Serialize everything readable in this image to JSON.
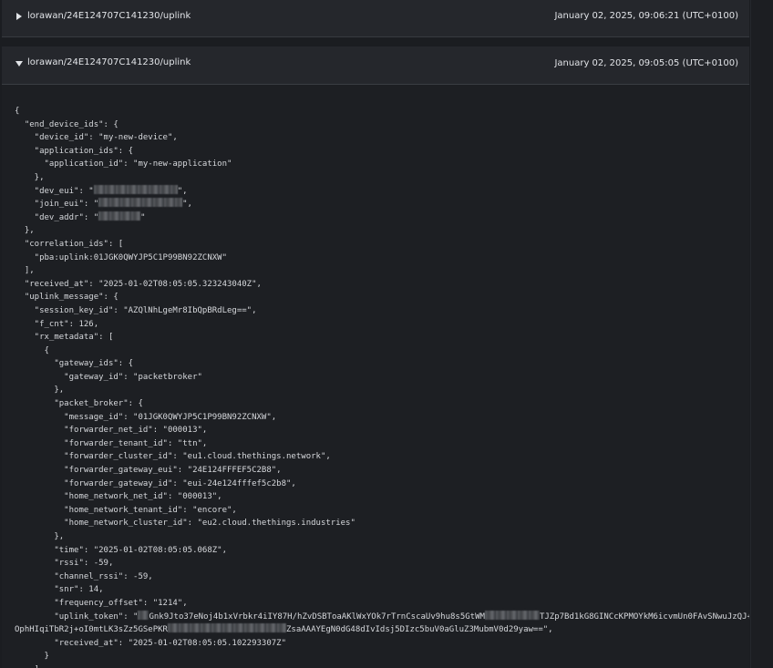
{
  "messages": [
    {
      "topic": "lorawan/24E124707C141230/uplink",
      "date": "January 02, 2025, 09:06:21 (UTC+0100)",
      "expanded": false
    },
    {
      "topic": "lorawan/24E124707C141230/uplink",
      "date": "January 02, 2025, 09:05:05 (UTC+0100)",
      "expanded": true
    }
  ],
  "payload": {
    "l1": "{",
    "l2": "  \"end_device_ids\": {",
    "l3": "    \"device_id\": \"my-new-device\",",
    "l4": "    \"application_ids\": {",
    "l5": "      \"application_id\": \"my-new-application\"",
    "l6": "    },",
    "l7": "    \"dev_eui\": \"",
    "l7b": "\",",
    "l8": "    \"join_eui\": \"",
    "l8b": "\",",
    "l9": "    \"dev_addr\": \"",
    "l9b": "\"",
    "l10": "  },",
    "l11": "  \"correlation_ids\": [",
    "l12": "    \"pba:uplink:01JGK0QWYJP5C1P99BN92ZCNXW\"",
    "l13": "  ],",
    "l14": "  \"received_at\": \"2025-01-02T08:05:05.323243040Z\",",
    "l15": "  \"uplink_message\": {",
    "l16": "    \"session_key_id\": \"AZQlNhLgeMr8IbQpBRdLeg==\",",
    "l17": "    \"f_cnt\": 126,",
    "l18": "    \"rx_metadata\": [",
    "l19": "      {",
    "l20": "        \"gateway_ids\": {",
    "l21": "          \"gateway_id\": \"packetbroker\"",
    "l22": "        },",
    "l23": "        \"packet_broker\": {",
    "l24": "          \"message_id\": \"01JGK0QWYJP5C1P99BN92ZCNXW\",",
    "l25": "          \"forwarder_net_id\": \"000013\",",
    "l26": "          \"forwarder_tenant_id\": \"ttn\",",
    "l27": "          \"forwarder_cluster_id\": \"eu1.cloud.thethings.network\",",
    "l28": "          \"forwarder_gateway_eui\": \"24E124FFFEF5C2B8\",",
    "l29": "          \"forwarder_gateway_id\": \"eui-24e124fffef5c2b8\",",
    "l30": "          \"home_network_net_id\": \"000013\",",
    "l31": "          \"home_network_tenant_id\": \"encore\",",
    "l32": "          \"home_network_cluster_id\": \"eu2.cloud.thethings.industries\"",
    "l33": "        },",
    "l34": "        \"time\": \"2025-01-02T08:05:05.068Z\",",
    "l35": "        \"rssi\": -59,",
    "l36": "        \"channel_rssi\": -59,",
    "l37": "        \"snr\": 14,",
    "l38": "        \"frequency_offset\": \"1214\",",
    "l39": "        \"uplink_token\": \"",
    "l39b": "Gnk9Jto37eNoj4b1xVrbkr4iIY87H/hZvDSBToaAKlWxYOk7rTrnCscaUv9hu8s5GtWM",
    "l39c": "TJZp7Bd1kG8GINCcKPMOYkM6icvmUn0FAvSNwuJzQJ+1",
    "l40": "OphHIqiTbR2j+oI0mtLK3sZz5GSePKR",
    "l40b": "ZsaAAAYEgN0dG48dIvIdsj5DIzc5buV0aGluZ3MubmV0d29yaw==\",",
    "l41": "        \"received_at\": \"2025-01-02T08:05:05.102293307Z\"",
    "l42": "      }",
    "l43": "    ],"
  },
  "icons": {
    "collapsed": "caret-right-icon",
    "expanded": "caret-down-icon"
  },
  "colors": {
    "background": "#1b1d21",
    "panel_header": "#25272c",
    "code_background": "#1d1f23",
    "text": "#d6d8dc"
  }
}
